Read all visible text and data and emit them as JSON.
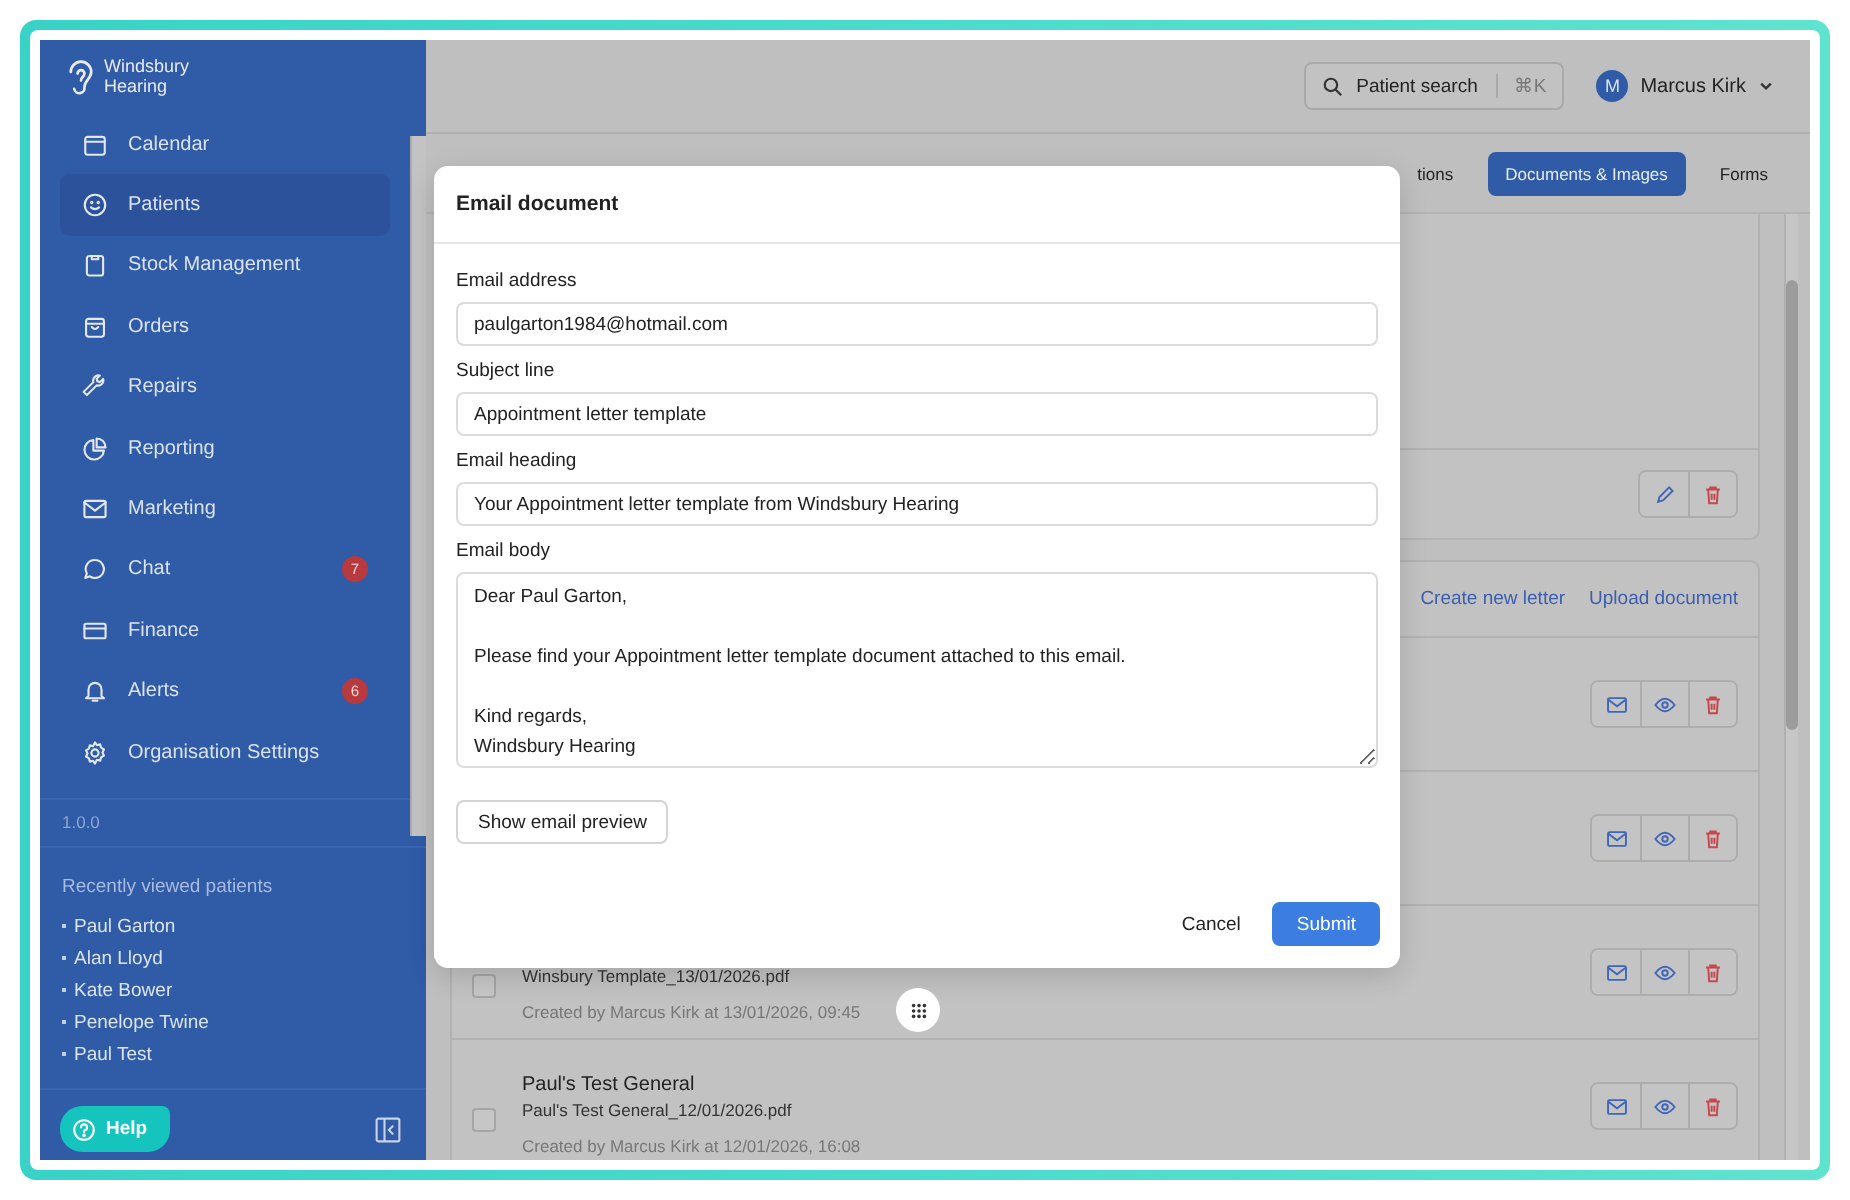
{
  "brand": {
    "name": "Windsbury Hearing"
  },
  "sidebar": {
    "items": [
      {
        "label": "Calendar",
        "selected": false
      },
      {
        "label": "Patients",
        "selected": true
      },
      {
        "label": "Stock Management",
        "selected": false
      },
      {
        "label": "Orders",
        "selected": false
      },
      {
        "label": "Repairs",
        "selected": false
      },
      {
        "label": "Reporting",
        "selected": false
      },
      {
        "label": "Marketing",
        "selected": false
      },
      {
        "label": "Chat",
        "selected": false,
        "badge": "7"
      },
      {
        "label": "Finance",
        "selected": false
      },
      {
        "label": "Alerts",
        "selected": false,
        "badge": "6"
      },
      {
        "label": "Organisation Settings",
        "selected": false
      }
    ],
    "version": "1.0.0",
    "recent_title": "Recently viewed patients",
    "recent": [
      "Paul Garton",
      "Alan Lloyd",
      "Kate Bower",
      "Penelope Twine",
      "Paul Test"
    ],
    "help": "Help"
  },
  "topbar": {
    "search": {
      "label": "Patient search",
      "shortcut": "⌘K"
    },
    "user": {
      "initial": "M",
      "name": "Marcus Kirk"
    }
  },
  "tabs": [
    {
      "label": "tions",
      "selected": false
    },
    {
      "label": "Documents & Images",
      "selected": true
    },
    {
      "label": "Forms",
      "selected": false
    }
  ],
  "documents": {
    "actions": [
      "Create new letter",
      "Upload document"
    ],
    "rows": [
      {
        "checked": false,
        "file": "Winsbury Template_13/01/2026.pdf",
        "meta": "Created by Marcus Kirk at 13/01/2026, 09:45"
      },
      {
        "checked": false,
        "title": "Paul's Test General",
        "file": "Paul's Test General_12/01/2026.pdf",
        "meta": "Created by Marcus Kirk at 12/01/2026, 16:08"
      }
    ]
  },
  "modal": {
    "title": "Email document",
    "fields": [
      {
        "kind": "input",
        "label": "Email address",
        "value": "paulgarton1984@hotmail.com"
      },
      {
        "kind": "input",
        "label": "Subject line",
        "value": "Appointment letter template"
      },
      {
        "kind": "input",
        "label": "Email heading",
        "value": "Your Appointment letter template from Windsbury Hearing"
      },
      {
        "kind": "textarea",
        "label": "Email body",
        "value": "Dear Paul Garton,\n\nPlease find your Appointment letter template document attached to this email.\n\nKind regards,\nWindsbury Hearing"
      }
    ],
    "preview_button": "Show email preview",
    "cancel": "Cancel",
    "submit": "Submit"
  }
}
